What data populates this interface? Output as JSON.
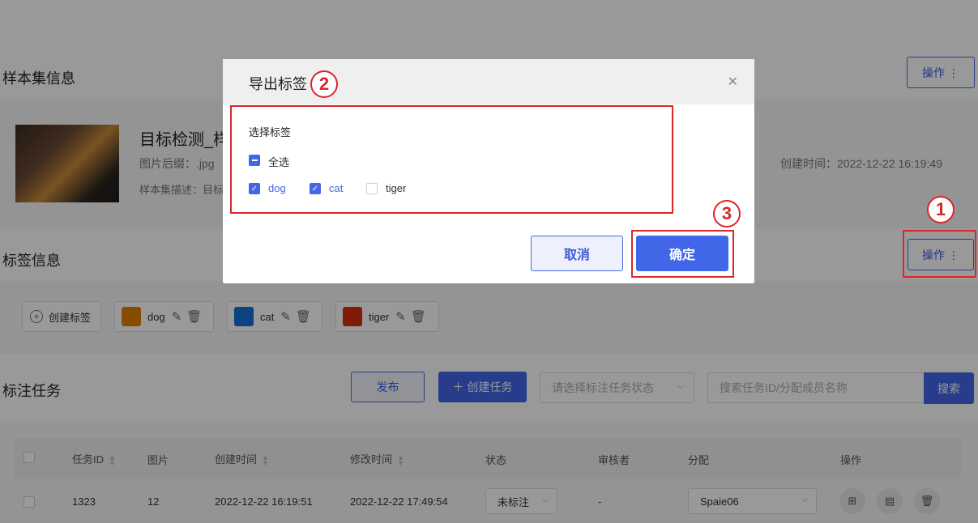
{
  "sample_set": {
    "section_title": "样本集信息",
    "op_button": "操作 ⋮",
    "name": "目标检测_样",
    "suffix_label": "图片后缀：.jpg",
    "desc_label": "样本集描述：目标",
    "created": "创建时间：2022-12-22 16:19:49"
  },
  "labels": {
    "section_title": "标签信息",
    "op_button": "操作 ⋮",
    "create_button": "创建标签",
    "items": [
      {
        "name": "dog",
        "color": "#e07f00"
      },
      {
        "name": "cat",
        "color": "#1470d8"
      },
      {
        "name": "tiger",
        "color": "#d6300b"
      }
    ]
  },
  "tasks": {
    "section_title": "标注任务",
    "publish_button": "发布",
    "create_button": "＋ 创建任务",
    "status_placeholder": "请选择标注任务状态",
    "search_placeholder": "搜索任务ID/分配成员名称",
    "search_button": "搜索",
    "columns": [
      "任务ID",
      "图片",
      "创建时间",
      "修改时间",
      "状态",
      "审核者",
      "分配",
      "操作"
    ],
    "rows": [
      {
        "id": "1323",
        "images": "12",
        "created": "2022-12-22 16:19:51",
        "modified": "2022-12-22 17:49:54",
        "status": "未标注",
        "reviewer": "-",
        "assignee": "Spaie06"
      }
    ]
  },
  "modal": {
    "title": "导出标签",
    "section_label": "选择标签",
    "select_all": "全选",
    "options": [
      {
        "label": "dog",
        "checked": true
      },
      {
        "label": "cat",
        "checked": true
      },
      {
        "label": "tiger",
        "checked": false
      }
    ],
    "cancel": "取消",
    "confirm": "确定"
  },
  "annotations": {
    "one": "1",
    "two": "2",
    "three": "3"
  }
}
